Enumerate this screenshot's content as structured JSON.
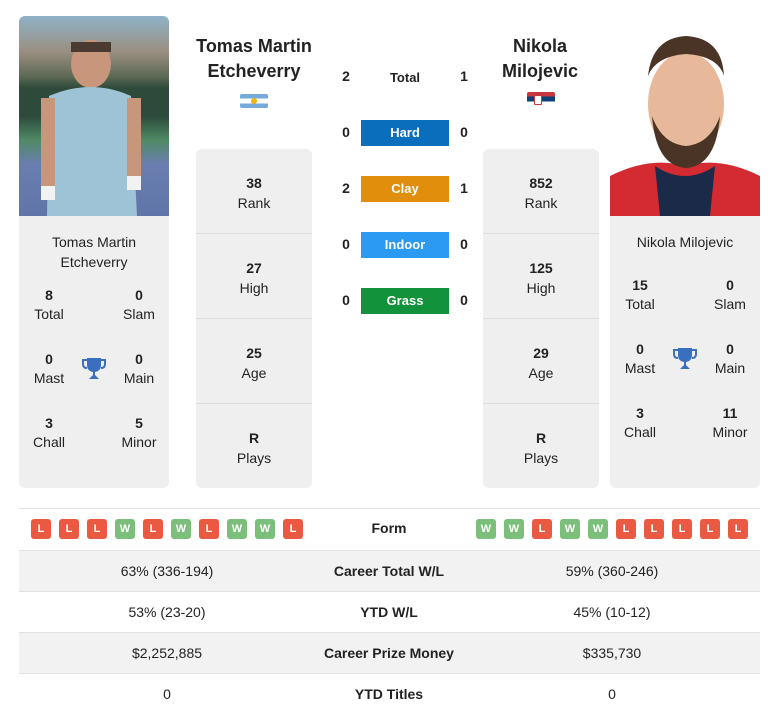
{
  "player1": {
    "name": "Tomas Martin Etcheverry",
    "name_line1": "Tomas Martin",
    "name_line2": "Etcheverry",
    "country_flag": "argentina-flag",
    "photo": "player1-photo",
    "titles": {
      "total": {
        "value": "8",
        "label": "Total"
      },
      "slam": {
        "value": "0",
        "label": "Slam"
      },
      "mast": {
        "value": "0",
        "label": "Mast"
      },
      "main": {
        "value": "0",
        "label": "Main"
      },
      "chall": {
        "value": "3",
        "label": "Chall"
      },
      "minor": {
        "value": "5",
        "label": "Minor"
      }
    },
    "stats": [
      {
        "value": "38",
        "label": "Rank"
      },
      {
        "value": "27",
        "label": "High"
      },
      {
        "value": "25",
        "label": "Age"
      },
      {
        "value": "R",
        "label": "Plays"
      }
    ],
    "form": [
      "L",
      "L",
      "L",
      "W",
      "L",
      "W",
      "L",
      "W",
      "W",
      "L"
    ]
  },
  "player2": {
    "name": "Nikola Milojevic",
    "name_line1": "Nikola",
    "name_line2": "Milojevic",
    "country_flag": "serbia-flag",
    "photo": "player2-photo",
    "titles": {
      "total": {
        "value": "15",
        "label": "Total"
      },
      "slam": {
        "value": "0",
        "label": "Slam"
      },
      "mast": {
        "value": "0",
        "label": "Mast"
      },
      "main": {
        "value": "0",
        "label": "Main"
      },
      "chall": {
        "value": "3",
        "label": "Chall"
      },
      "minor": {
        "value": "11",
        "label": "Minor"
      }
    },
    "stats": [
      {
        "value": "852",
        "label": "Rank"
      },
      {
        "value": "125",
        "label": "High"
      },
      {
        "value": "29",
        "label": "Age"
      },
      {
        "value": "R",
        "label": "Plays"
      }
    ],
    "form": [
      "W",
      "W",
      "L",
      "W",
      "W",
      "L",
      "L",
      "L",
      "L",
      "L"
    ]
  },
  "h2h": {
    "total": {
      "label": "Total",
      "p1": "2",
      "p2": "1"
    },
    "surfaces": [
      {
        "label": "Hard",
        "p1": "0",
        "p2": "0",
        "color": "#0a6ebd"
      },
      {
        "label": "Clay",
        "p1": "2",
        "p2": "1",
        "color": "#e08e0b"
      },
      {
        "label": "Indoor",
        "p1": "0",
        "p2": "0",
        "color": "#2b9af3"
      },
      {
        "label": "Grass",
        "p1": "0",
        "p2": "0",
        "color": "#12923a"
      }
    ]
  },
  "comparison": {
    "form_label": "Form",
    "rows": [
      {
        "label": "Career Total W/L",
        "p1": "63% (336-194)",
        "p2": "59% (360-246)"
      },
      {
        "label": "YTD W/L",
        "p1": "53% (23-20)",
        "p2": "45% (10-12)"
      },
      {
        "label": "Career Prize Money",
        "p1": "$2,252,885",
        "p2": "$335,730"
      },
      {
        "label": "YTD Titles",
        "p1": "0",
        "p2": "0"
      }
    ]
  },
  "colors": {
    "win": "#7cbf7a",
    "loss": "#ea5a42",
    "trophy": "#3a6fbf",
    "card_bg": "#efefef"
  }
}
